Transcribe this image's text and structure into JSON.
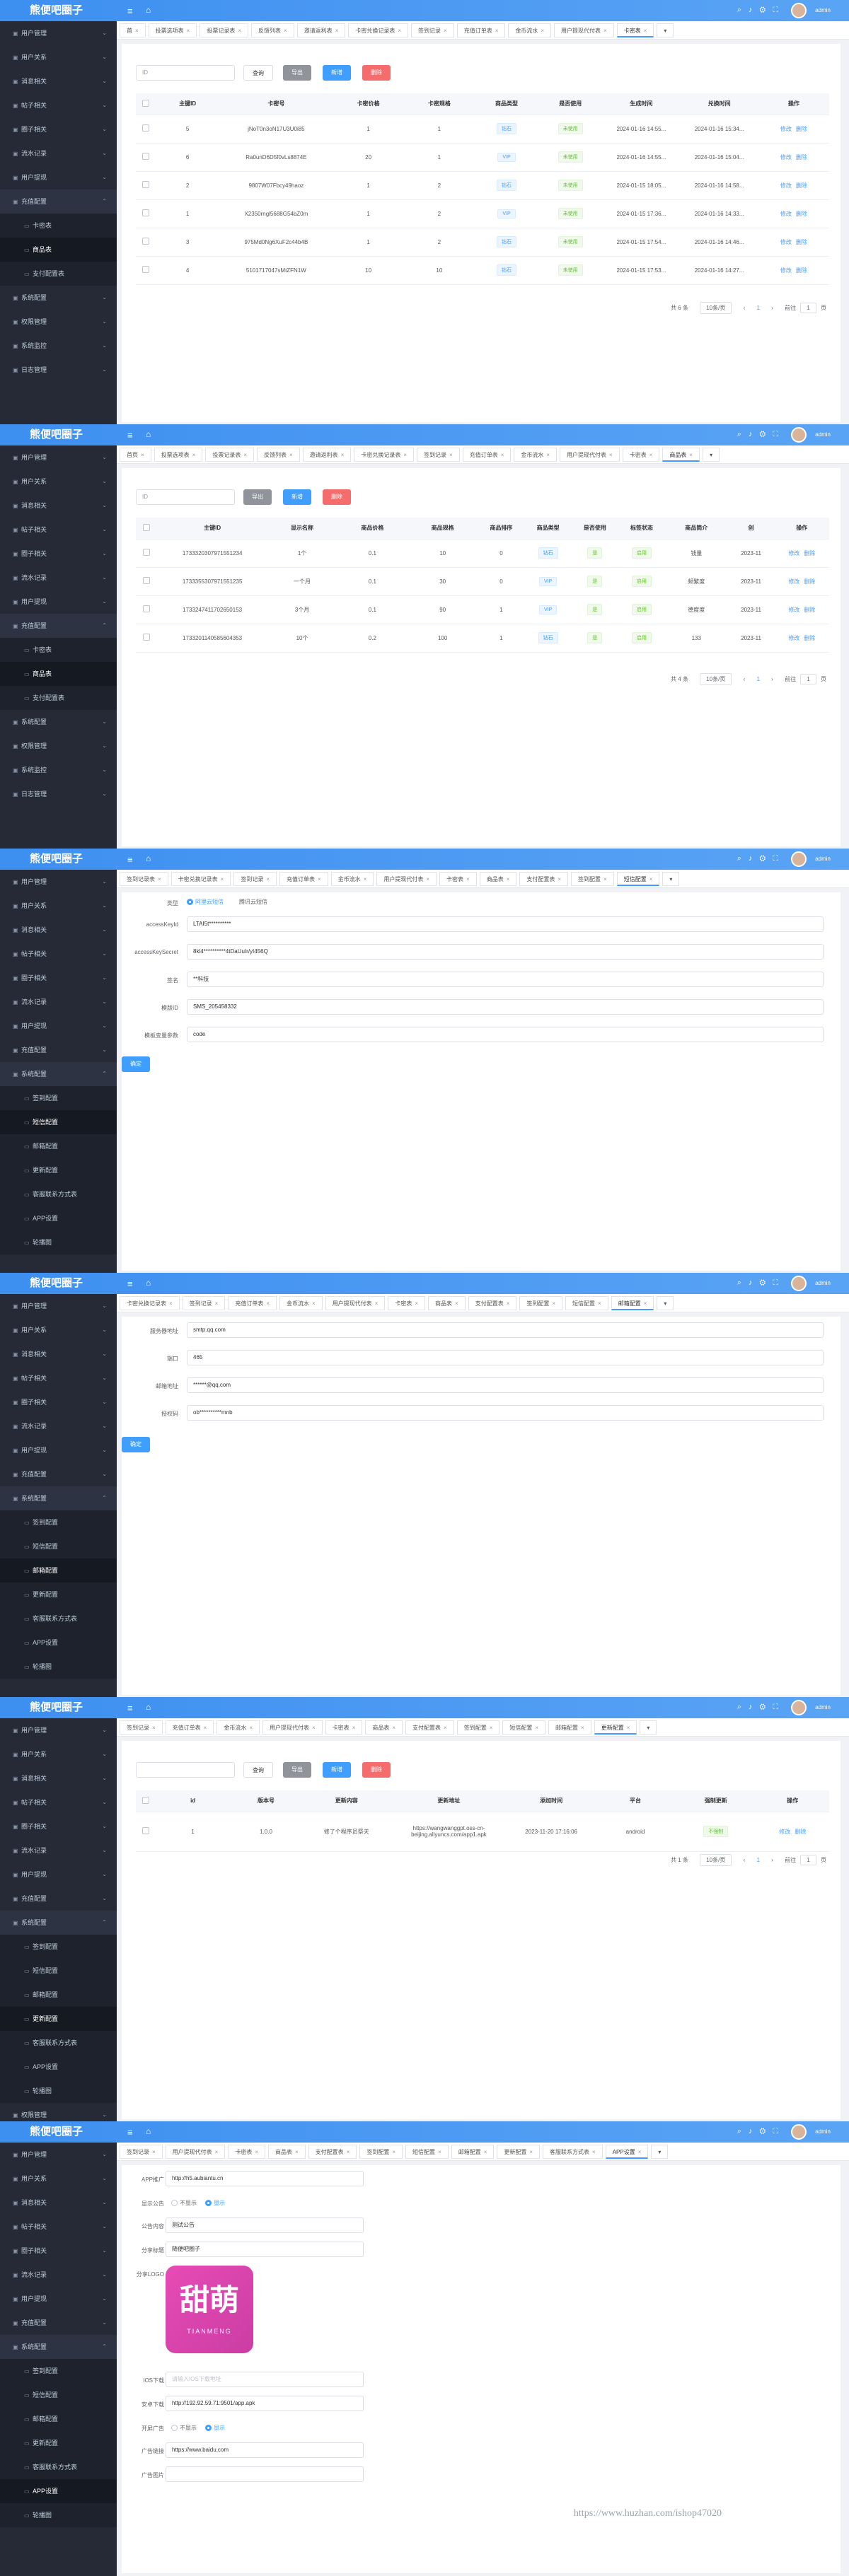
{
  "app": {
    "title": "熊便吧圈子",
    "user": "admin",
    "icons": [
      "search-icon",
      "bell-icon",
      "gear-icon",
      "fullscreen-icon"
    ]
  },
  "sidebar_top": [
    "用户管理",
    "用户关系",
    "消息相关",
    "帖子相关",
    "圈子相关",
    "流水记录",
    "用户提现"
  ],
  "sidebar_bottom": [
    "系统配置",
    "权限管理",
    "系统监控",
    "日志管理"
  ],
  "screen1": {
    "tags": [
      "首",
      "投票选项表",
      "投票记录表",
      "反馈列表",
      "邀请返利表",
      "卡密兑换记录表",
      "签到记录",
      "充值订单表",
      "金币流水",
      "用户提现代付表",
      "卡密表"
    ],
    "sidebar": [
      {
        "l": "用户管理",
        "t": "n"
      },
      {
        "l": "用户关系",
        "t": "n"
      },
      {
        "l": "消息相关",
        "t": "n"
      },
      {
        "l": "帖子相关",
        "t": "n"
      },
      {
        "l": "圈子相关",
        "t": "n"
      },
      {
        "l": "流水记录",
        "t": "n"
      },
      {
        "l": "用户提现",
        "t": "n"
      },
      {
        "l": "充值配置",
        "t": "g"
      },
      {
        "l": "卡密表",
        "t": "s"
      },
      {
        "l": "商品表",
        "t": "so"
      },
      {
        "l": "支付配置表",
        "t": "s"
      },
      {
        "l": "系统配置",
        "t": "n"
      },
      {
        "l": "权限管理",
        "t": "n"
      },
      {
        "l": "系统监控",
        "t": "n"
      },
      {
        "l": "日志管理",
        "t": "n"
      }
    ],
    "search_placeholder": "ID",
    "buttons": [
      "查询",
      "导出",
      "新增",
      "删除"
    ],
    "headers": [
      "",
      "主键ID",
      "卡密号",
      "卡密价格",
      "卡密规格",
      "商品类型",
      "是否使用",
      "生成时间",
      "兑换时间",
      "操作"
    ],
    "rows": [
      [
        "5",
        "jNoT0n3oN17U3U0i85",
        "1",
        "1",
        "钻石",
        "未使用",
        "2024-01-16 14:55...",
        "2024-01-16 15:34..."
      ],
      [
        "6",
        "Ra0unD6D5f0vLs8874E",
        "20",
        "1",
        "VIP",
        "未使用",
        "2024-01-16 14:55...",
        "2024-01-16 15:04..."
      ],
      [
        "2",
        "9807W07Fbcy49haoz",
        "1",
        "2",
        "钻石",
        "未使用",
        "2024-01-15 18:05...",
        "2024-01-16 14:58..."
      ],
      [
        "1",
        "X2350rngl5688G54bZ0m",
        "1",
        "2",
        "VIP",
        "未使用",
        "2024-01-15 17:36...",
        "2024-01-16 14:33..."
      ],
      [
        "3",
        "975Md0Ng6XuF2c44b4B",
        "1",
        "2",
        "钻石",
        "未使用",
        "2024-01-15 17:54...",
        "2024-01-16 14:46..."
      ],
      [
        "4",
        "5101717047sMtZFN1W",
        "10",
        "10",
        "钻石",
        "未使用",
        "2024-01-15 17:53...",
        "2024-01-16 14:27..."
      ]
    ],
    "ops": [
      "修改",
      "删除"
    ],
    "pager": {
      "total": "共 6 条",
      "size": "10条/页",
      "page": "1",
      "goto": "前往",
      "goto_val": "1",
      "unit": "页"
    }
  },
  "screen2": {
    "tags": [
      "首页",
      "投票选项表",
      "投票记录表",
      "反馈列表",
      "邀请返利表",
      "卡密兑换记录表",
      "签到记录",
      "充值订单表",
      "金币流水",
      "用户提现代付表",
      "卡密表",
      "商品表"
    ],
    "sidebar": [
      {
        "l": "用户管理",
        "t": "n"
      },
      {
        "l": "用户关系",
        "t": "n"
      },
      {
        "l": "消息相关",
        "t": "n"
      },
      {
        "l": "帖子相关",
        "t": "n"
      },
      {
        "l": "圈子相关",
        "t": "n"
      },
      {
        "l": "流水记录",
        "t": "n"
      },
      {
        "l": "用户提现",
        "t": "n"
      },
      {
        "l": "充值配置",
        "t": "g"
      },
      {
        "l": "卡密表",
        "t": "s"
      },
      {
        "l": "商品表",
        "t": "so"
      },
      {
        "l": "支付配置表",
        "t": "s"
      },
      {
        "l": "系统配置",
        "t": "n"
      },
      {
        "l": "权限管理",
        "t": "n"
      },
      {
        "l": "系统监控",
        "t": "n"
      },
      {
        "l": "日志管理",
        "t": "n"
      }
    ],
    "search_placeholder": "ID",
    "buttons": [
      "导出",
      "新增",
      "删除"
    ],
    "headers": [
      "",
      "主键ID",
      "显示名称",
      "商品价格",
      "商品规格",
      "商品排序",
      "商品类型",
      "是否使用",
      "标签状态",
      "商品简介",
      "创",
      "操作"
    ],
    "rows": [
      [
        "1733320307971551234",
        "1个",
        "0.1",
        "10",
        "0",
        "钻石",
        "是",
        "启用",
        "钱量",
        "2023-11"
      ],
      [
        "1733355307971551235",
        "一个月",
        "0.1",
        "30",
        "0",
        "VIP",
        "是",
        "启用",
        "频繁度",
        "2023-11"
      ],
      [
        "1733247411702650153",
        "3个月",
        "0.1",
        "90",
        "1",
        "VIP",
        "是",
        "启用",
        "德度度",
        "2023-11"
      ],
      [
        "1733201140585604353",
        "10个",
        "0.2",
        "100",
        "1",
        "钻石",
        "是",
        "启用",
        "133",
        "2023-11"
      ]
    ],
    "ops": [
      "修改",
      "删除"
    ],
    "pager": {
      "total": "共 4 条",
      "size": "10条/页",
      "page": "1",
      "goto": "前往",
      "goto_val": "1",
      "unit": "页"
    }
  },
  "screen3": {
    "tags": [
      "签到记录表",
      "卡密兑换记录表",
      "签到记录",
      "充值订单表",
      "金币流水",
      "用户提现代付表",
      "卡密表",
      "商品表",
      "支付配置表",
      "签到配置",
      "短信配置"
    ],
    "sidebar": [
      {
        "l": "用户管理",
        "t": "n"
      },
      {
        "l": "用户关系",
        "t": "n"
      },
      {
        "l": "消息相关",
        "t": "n"
      },
      {
        "l": "帖子相关",
        "t": "n"
      },
      {
        "l": "圈子相关",
        "t": "n"
      },
      {
        "l": "流水记录",
        "t": "n"
      },
      {
        "l": "用户提现",
        "t": "n"
      },
      {
        "l": "充值配置",
        "t": "n"
      },
      {
        "l": "系统配置",
        "t": "g"
      },
      {
        "l": "签到配置",
        "t": "s"
      },
      {
        "l": "短信配置",
        "t": "so"
      },
      {
        "l": "邮箱配置",
        "t": "s"
      },
      {
        "l": "更新配置",
        "t": "s"
      },
      {
        "l": "客服联系方式表",
        "t": "s"
      },
      {
        "l": "APP设置",
        "t": "s"
      },
      {
        "l": "轮播图",
        "t": "s"
      }
    ],
    "type_label": "类型",
    "type_opts": [
      "阿里云短信",
      "腾讯云短信"
    ],
    "fields": [
      {
        "label": "accessKeyId",
        "value": "LTAI5t**********"
      },
      {
        "label": "accessKeySecret",
        "value": "8kl4**********4tDaUuIr/yI456Q"
      },
      {
        "label": "签名",
        "value": "**科技"
      },
      {
        "label": "模版ID",
        "value": "SMS_205458332"
      },
      {
        "label": "模板变量参数",
        "value": "code"
      }
    ],
    "submit": "确定"
  },
  "screen4": {
    "tags": [
      "卡密兑换记录表",
      "签到记录",
      "充值订单表",
      "金币流水",
      "用户提现代付表",
      "卡密表",
      "商品表",
      "支付配置表",
      "签到配置",
      "短信配置",
      "邮箱配置"
    ],
    "sidebar": [
      {
        "l": "用户管理",
        "t": "n"
      },
      {
        "l": "用户关系",
        "t": "n"
      },
      {
        "l": "消息相关",
        "t": "n"
      },
      {
        "l": "帖子相关",
        "t": "n"
      },
      {
        "l": "圈子相关",
        "t": "n"
      },
      {
        "l": "流水记录",
        "t": "n"
      },
      {
        "l": "用户提现",
        "t": "n"
      },
      {
        "l": "充值配置",
        "t": "n"
      },
      {
        "l": "系统配置",
        "t": "g"
      },
      {
        "l": "签到配置",
        "t": "s"
      },
      {
        "l": "短信配置",
        "t": "s"
      },
      {
        "l": "邮箱配置",
        "t": "so"
      },
      {
        "l": "更新配置",
        "t": "s"
      },
      {
        "l": "客服联系方式表",
        "t": "s"
      },
      {
        "l": "APP设置",
        "t": "s"
      },
      {
        "l": "轮播图",
        "t": "s"
      }
    ],
    "fields": [
      {
        "label": "服务器地址",
        "value": "smtp.qq.com"
      },
      {
        "label": "端口",
        "value": "465"
      },
      {
        "label": "邮箱地址",
        "value": "******@qq.com"
      },
      {
        "label": "授权码",
        "value": "ob**********mnb"
      }
    ],
    "submit": "确定"
  },
  "screen5": {
    "tags": [
      "签到记录",
      "充值订单表",
      "金币流水",
      "用户提现代付表",
      "卡密表",
      "商品表",
      "支付配置表",
      "签到配置",
      "短信配置",
      "邮箱配置",
      "更新配置"
    ],
    "sidebar": [
      {
        "l": "用户管理",
        "t": "n"
      },
      {
        "l": "用户关系",
        "t": "n"
      },
      {
        "l": "消息相关",
        "t": "n"
      },
      {
        "l": "帖子相关",
        "t": "n"
      },
      {
        "l": "圈子相关",
        "t": "n"
      },
      {
        "l": "流水记录",
        "t": "n"
      },
      {
        "l": "用户提现",
        "t": "n"
      },
      {
        "l": "充值配置",
        "t": "n"
      },
      {
        "l": "系统配置",
        "t": "g"
      },
      {
        "l": "签到配置",
        "t": "s"
      },
      {
        "l": "短信配置",
        "t": "s"
      },
      {
        "l": "邮箱配置",
        "t": "s"
      },
      {
        "l": "更新配置",
        "t": "so"
      },
      {
        "l": "客服联系方式表",
        "t": "s"
      },
      {
        "l": "APP设置",
        "t": "s"
      },
      {
        "l": "轮播图",
        "t": "s"
      },
      {
        "l": "权限管理",
        "t": "n"
      }
    ],
    "search_placeholder": "",
    "buttons": [
      "查询",
      "导出",
      "新增",
      "删除"
    ],
    "headers": [
      "",
      "id",
      "版本号",
      "更新内容",
      "更新地址",
      "添加时间",
      "平台",
      "强制更新",
      "操作"
    ],
    "rows": [
      [
        "1",
        "1.0.0",
        "修了个程序员祭天",
        "https://wangwanggpt.oss-cn-beijing.aliyuncs.com/app1.apk",
        "2023-11-20 17:16:06",
        "android",
        "不强制"
      ]
    ],
    "ops": [
      "修改",
      "删除"
    ],
    "pager": {
      "total": "共 1 条",
      "size": "10条/页",
      "page": "1",
      "goto": "前往",
      "goto_val": "1",
      "unit": "页"
    }
  },
  "screen6": {
    "tags": [
      "签到记录",
      "用户提现代付表",
      "卡密表",
      "商品表",
      "支付配置表",
      "签到配置",
      "短信配置",
      "邮箱配置",
      "更新配置",
      "客服联系方式表",
      "APP设置"
    ],
    "sidebar": [
      {
        "l": "用户管理",
        "t": "n"
      },
      {
        "l": "用户关系",
        "t": "n"
      },
      {
        "l": "消息相关",
        "t": "n"
      },
      {
        "l": "帖子相关",
        "t": "n"
      },
      {
        "l": "圈子相关",
        "t": "n"
      },
      {
        "l": "流水记录",
        "t": "n"
      },
      {
        "l": "用户提现",
        "t": "n"
      },
      {
        "l": "充值配置",
        "t": "n"
      },
      {
        "l": "系统配置",
        "t": "g"
      },
      {
        "l": "签到配置",
        "t": "s"
      },
      {
        "l": "短信配置",
        "t": "s"
      },
      {
        "l": "邮箱配置",
        "t": "s"
      },
      {
        "l": "更新配置",
        "t": "s"
      },
      {
        "l": "客服联系方式表",
        "t": "s"
      },
      {
        "l": "APP设置",
        "t": "so"
      },
      {
        "l": "轮播图",
        "t": "s"
      }
    ],
    "fields": [
      {
        "label": "APP推广",
        "value": "http://h5.aubiantu.cn"
      },
      {
        "label": "显示公告",
        "radio": [
          "不显示",
          "显示"
        ],
        "sel": 1
      },
      {
        "label": "公告内容",
        "value": "测试公告"
      },
      {
        "label": "分享标题",
        "value": "随便吧圈子"
      },
      {
        "label": "分享LOGO",
        "logo": true
      },
      {
        "label": "IOS下载",
        "value": "",
        "ph": "请输入IOS下载地址"
      },
      {
        "label": "安卓下载",
        "value": "http://192.92.59.71:9501/app.apk"
      },
      {
        "label": "开屏广告",
        "radio": [
          "不显示",
          "显示"
        ],
        "sel": 1
      },
      {
        "label": "广告链接",
        "value": "https://www.baidu.com"
      },
      {
        "label": "广告图片",
        "value": ""
      }
    ],
    "logo_text": "甜萌",
    "logo_sub": "TIANMENG",
    "watermark": "https://www.huzhan.com/ishop47020"
  }
}
